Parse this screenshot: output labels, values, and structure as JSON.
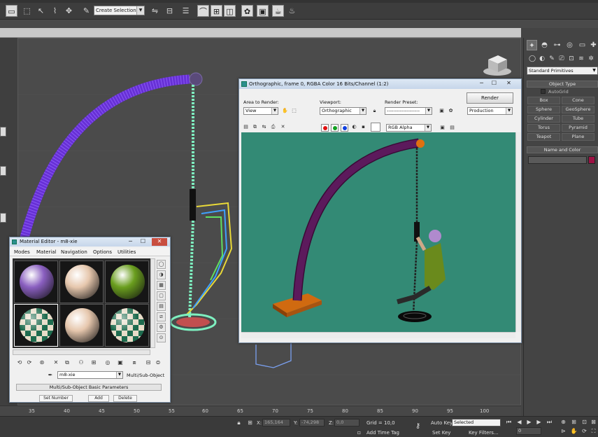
{
  "toolbar": {
    "selection_set": "Create Selection Se",
    "icons": [
      "window-icon",
      "select-object-icon",
      "pointer-icon",
      "fence-select-icon",
      "move-icon",
      "rotate-icon",
      "scale-icon",
      "snaps-toggle-icon",
      "angle-snap-icon",
      "percent-snap-icon",
      "edit-named-selection-icon",
      "mirror-icon",
      "align-icon",
      "layer-manager-icon",
      "curve-editor-icon",
      "schematic-view-icon",
      "material-editor-icon",
      "render-setup-icon",
      "rendered-frame-icon",
      "render-production-icon"
    ]
  },
  "command_panel": {
    "tab_icons": [
      "create-tab-icon",
      "modify-tab-icon",
      "hierarchy-tab-icon",
      "motion-tab-icon",
      "display-tab-icon",
      "utilities-tab-icon"
    ],
    "category_icons": [
      "geometry-icon",
      "shapes-icon",
      "lights-icon",
      "cameras-icon",
      "helpers-icon",
      "space-warps-icon",
      "systems-icon"
    ],
    "primitive_type": "Standard Primitives",
    "object_type_title": "Object Type",
    "autogrid": "AutoGrid",
    "objects": [
      "Box",
      "Cone",
      "Sphere",
      "GeoSphere",
      "Cylinder",
      "Tube",
      "Torus",
      "Pyramid",
      "Teapot",
      "Plane"
    ],
    "name_color_title": "Name and Color",
    "object_color": "#9e1244"
  },
  "render_window": {
    "title": "Orthographic, frame 0, RGBA Color 16 Bits/Channel (1:2)",
    "area_label": "Area to Render:",
    "area_value": "View",
    "viewport_label": "Viewport:",
    "viewport_value": "Orthographic",
    "preset_label": "Render Preset:",
    "preset_value": "--------------------",
    "render_button": "Render",
    "production_value": "Production",
    "channel_value": "RGB Alpha",
    "background_color": "#338a75",
    "channels": [
      {
        "name": "red-channel",
        "color": "#e01010"
      },
      {
        "name": "green-channel",
        "color": "#10a020"
      },
      {
        "name": "blue-channel",
        "color": "#1040e0"
      }
    ]
  },
  "material_editor": {
    "title": "Material Editor - m8-xie",
    "menu": [
      "Modes",
      "Material",
      "Navigation",
      "Options",
      "Utilities"
    ],
    "slots": [
      {
        "kind": "sphere",
        "color": "#8a5fc0"
      },
      {
        "kind": "sphere",
        "color": "#e6c7ad"
      },
      {
        "kind": "sphere",
        "color": "#6a9e1e"
      },
      {
        "kind": "checker",
        "color": "#1e6b4e"
      },
      {
        "kind": "sphere",
        "color": "#e6c7ad"
      },
      {
        "kind": "checker",
        "color": "#1e6b4e"
      }
    ],
    "material_name": "m8-xie",
    "material_type": "Multi/Sub-Object",
    "rollout_title": "Multi/Sub-Object Basic Parameters",
    "buttons": [
      "Set Number",
      "Add",
      "Delete"
    ]
  },
  "timeline": {
    "ticks": [
      "35",
      "40",
      "45",
      "50",
      "55",
      "60",
      "65",
      "70",
      "75",
      "80",
      "85",
      "90",
      "95",
      "100"
    ]
  },
  "status": {
    "x_label": "X:",
    "x_value": "165,164",
    "y_label": "Y:",
    "y_value": "-74,298",
    "z_label": "Z:",
    "z_value": "0,0",
    "grid": "Grid = 10,0",
    "add_time_tag": "Add Time Tag",
    "auto_key": "Auto Key",
    "auto_key_value": "Selected",
    "set_key": "Set Key",
    "key_filters": "Key Filters...",
    "frame_value": "0"
  }
}
